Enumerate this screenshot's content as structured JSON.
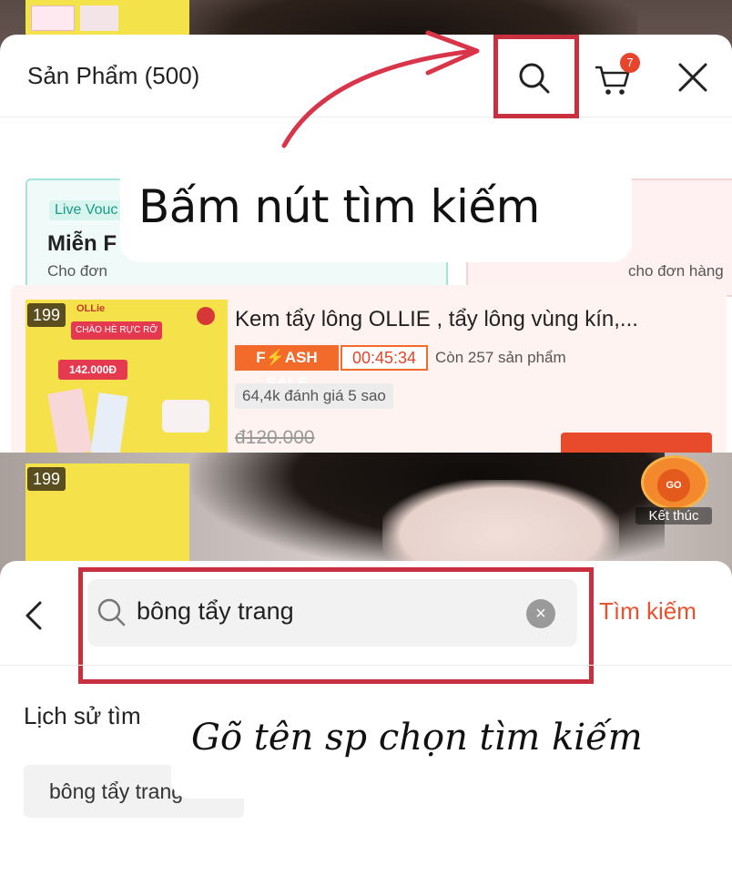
{
  "top": {
    "sheet_title": "Sản Phẩm (500)",
    "cart_count": "7",
    "annotation": "Bấm nút tìm kiếm",
    "voucher1": {
      "tag": "Live Vouc",
      "title": "Miễn F",
      "sub": "Cho đơn"
    },
    "voucher2": {
      "sub": "cho đơn hàng"
    },
    "product": {
      "badge": "199",
      "brand": "OLLie",
      "banner": "CHÀO HÈ RỰC RỠ",
      "price_tag": "142.000Đ",
      "name": "Kem tẩy lông OLLIE , tẩy lông vùng kín,...",
      "flash_label": "F⚡ASH SALE",
      "timer": "00:45:34",
      "remaining": "Còn 257 sản phẩm",
      "rating": "64,4k đánh giá 5 sao",
      "old_price": "đ120.000"
    }
  },
  "bottom": {
    "live_badge": "199",
    "go_label": "GO",
    "end_label": "Kết thúc",
    "search_value": "bông tẩy trang",
    "search_action": "Tìm kiếm",
    "history_title": "Lịch sử tìm",
    "history_items": [
      "bông tẩy trang"
    ],
    "annotation": "Gõ tên sp chọn tìm kiếm"
  },
  "colors": {
    "highlight": "#c8303f",
    "accent": "#e8522f",
    "flash_sale": "#f26b2a"
  },
  "icons": [
    "search-icon",
    "cart-icon",
    "close-icon",
    "back-icon",
    "clear-icon"
  ]
}
